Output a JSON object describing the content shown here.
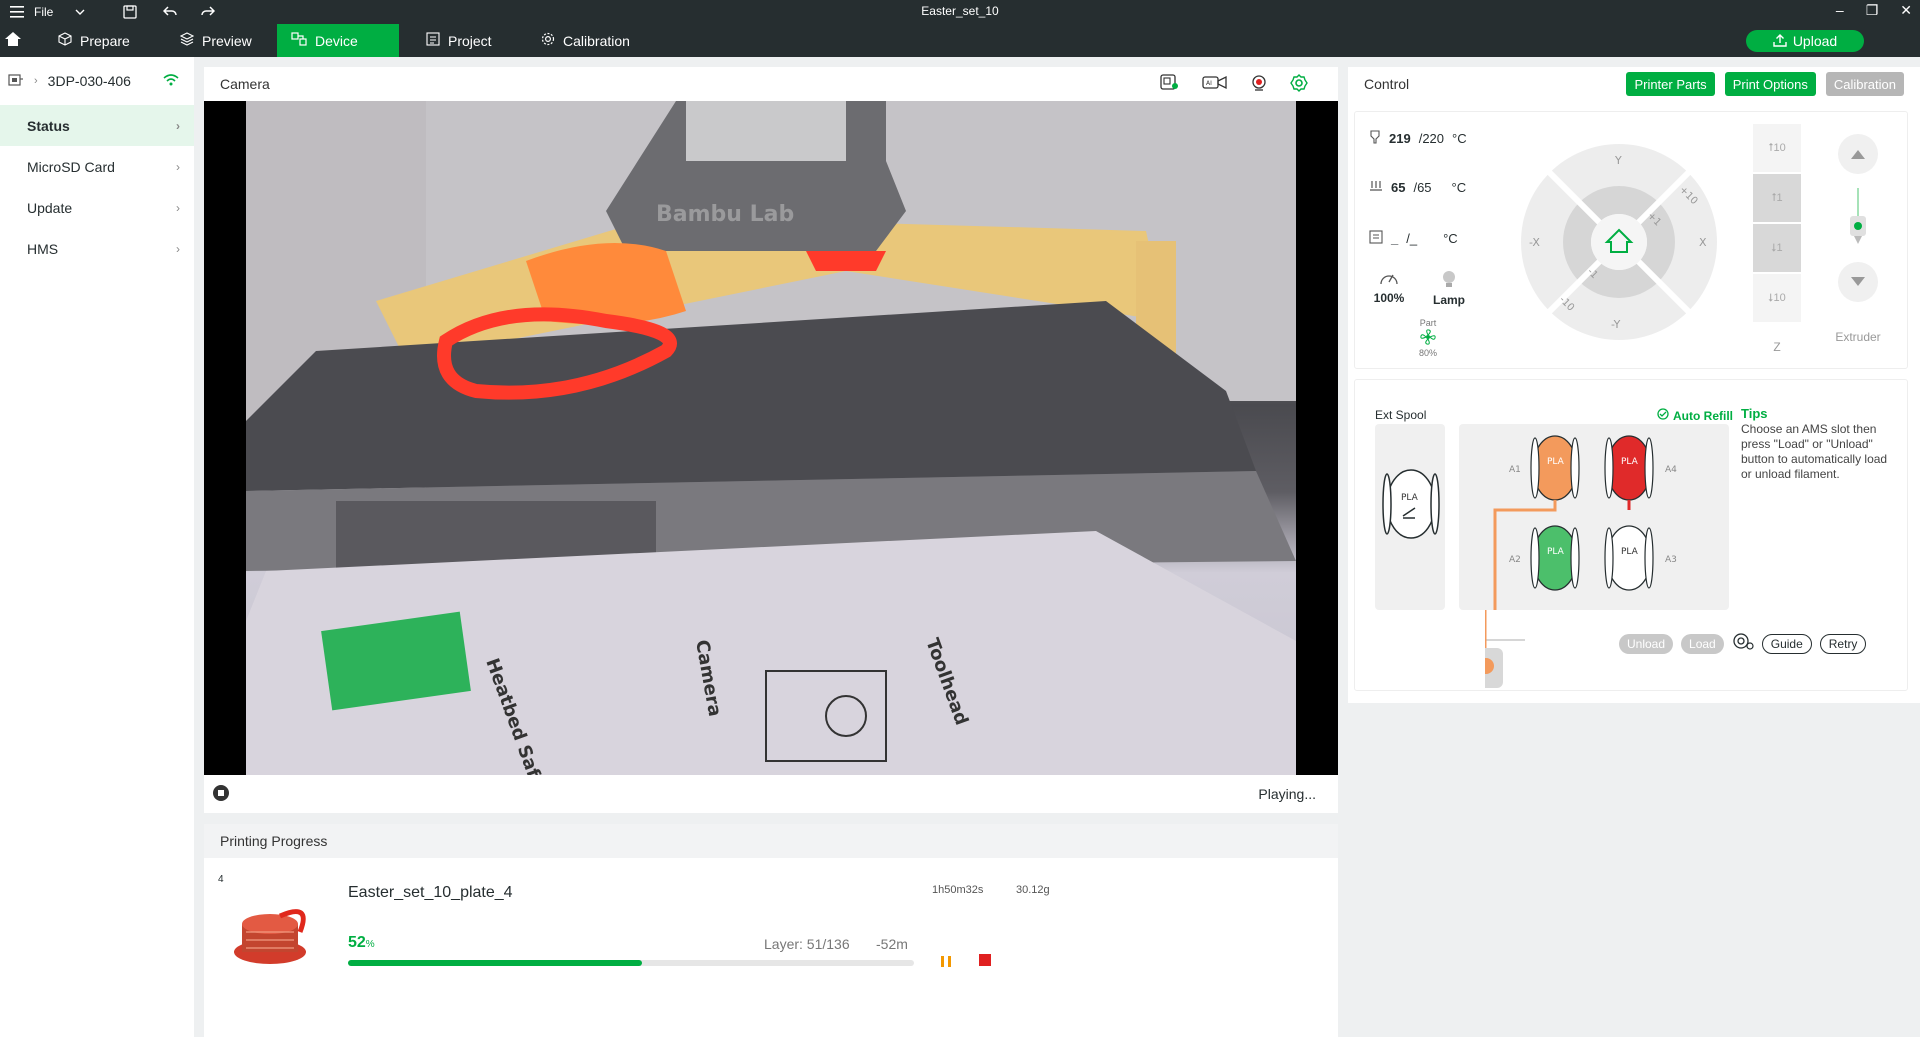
{
  "titlebar": {
    "file_label": "File",
    "title": "Easter_set_10"
  },
  "tabs": {
    "prepare": "Prepare",
    "preview": "Preview",
    "device": "Device",
    "project": "Project",
    "calibration": "Calibration",
    "upload": "Upload"
  },
  "sidebar": {
    "device_name": "3DP-030-406",
    "items": [
      "Status",
      "MicroSD Card",
      "Update",
      "HMS"
    ]
  },
  "camera": {
    "title": "Camera",
    "status": "Playing...",
    "overlay_text": [
      "Bambu Lab",
      "Heatbed Safety Zo",
      "Camera",
      "Toolhead"
    ]
  },
  "progress": {
    "title": "Printing Progress",
    "plate_number": "4",
    "job_name": "Easter_set_10_plate_4",
    "time": "1h50m32s",
    "weight": "30.12g",
    "percent_value": "52",
    "percent_unit": "%",
    "fraction": 0.52,
    "layer": "Layer: 51/136",
    "remaining": "-52m"
  },
  "control": {
    "title": "Control",
    "buttons": {
      "printer_parts": "Printer Parts",
      "print_options": "Print Options",
      "calibration": "Calibration"
    },
    "nozzle": {
      "current": "219",
      "target": "/220",
      "unit": "°C"
    },
    "bed": {
      "current": "65",
      "target": "/65",
      "unit": "°C"
    },
    "chamber": {
      "current": "_",
      "target": "/_",
      "unit": "°C"
    },
    "speed": "100%",
    "lamp": "Lamp",
    "fan": {
      "label": "Part",
      "value": "80%"
    },
    "jog": {
      "y": "Y",
      "neg_y": "-Y",
      "x": "X",
      "neg_x": "-X",
      "p10": "+10",
      "p1": "+1",
      "n1": "-1",
      "n10": "-10"
    },
    "z_buttons": [
      "10",
      "1",
      "1",
      "10"
    ],
    "z_label": "Z",
    "extruder_label": "Extruder"
  },
  "ams": {
    "ext_spool_label": "Ext Spool",
    "ext_spool_type": "PLA",
    "auto_refill": "Auto Refill",
    "tips_title": "Tips",
    "tips_text": "Choose an AMS slot then press \"Load\" or \"Unload\" button to automatically load or unload filament.",
    "slots": [
      {
        "id": "A1",
        "type": "PLA",
        "color": "#f39a5c"
      },
      {
        "id": "A4",
        "type": "PLA",
        "color": "#e02a2a"
      },
      {
        "id": "A2",
        "type": "PLA",
        "color": "#4cbf6b"
      },
      {
        "id": "A3",
        "type": "PLA",
        "color": "#ffffff"
      }
    ],
    "unload": "Unload",
    "load": "Load",
    "guide": "Guide",
    "retry": "Retry"
  }
}
